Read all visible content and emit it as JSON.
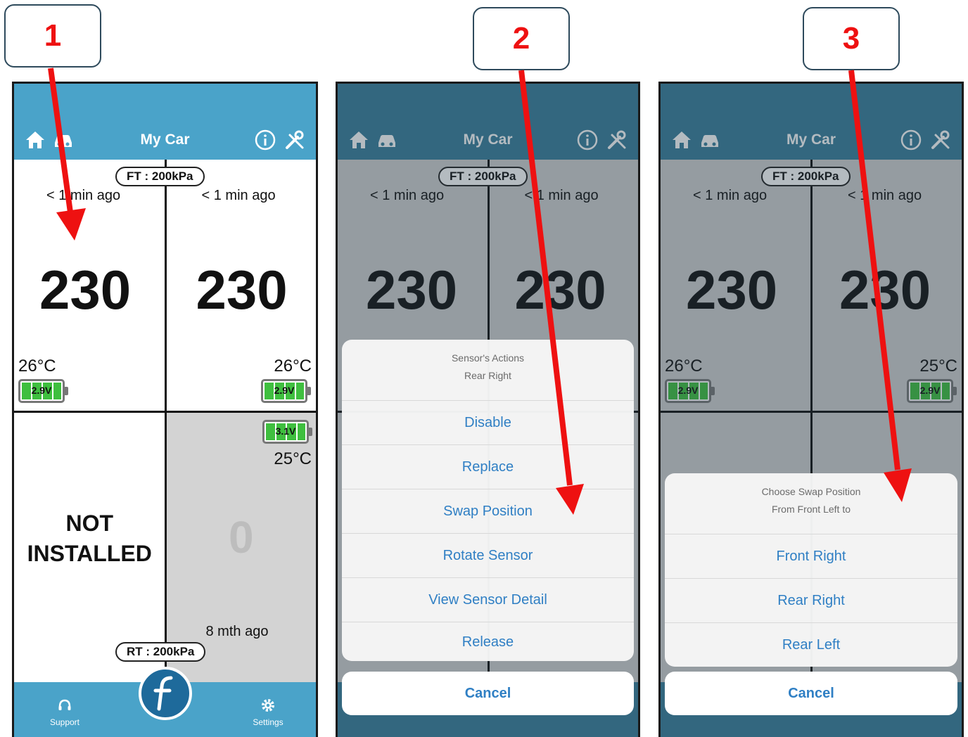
{
  "steps": [
    "1",
    "2",
    "3"
  ],
  "header": {
    "title": "My Car"
  },
  "pressure": {
    "front_label": "FT : 200kPa",
    "rear_label": "RT : 200kPa"
  },
  "tires": {
    "front_left": {
      "ago": "< 1 min ago",
      "value": "230",
      "temp": "26°C",
      "battery": "2.9V"
    },
    "front_right": {
      "ago": "< 1 min ago",
      "value": "230",
      "temp": "26°C",
      "battery": "2.9V"
    },
    "rear_left": {
      "status_line1": "NOT",
      "status_line2": "INSTALLED"
    },
    "rear_right": {
      "ago": "8 mth ago",
      "value": "0",
      "temp": "25°C",
      "battery": "3.1V"
    }
  },
  "screen3_front_right_temp": "25°C",
  "footer": {
    "support_label": "Support",
    "settings_label": "Settings"
  },
  "sensor_actions": {
    "title": "Sensor's Actions",
    "subtitle": "Rear Right",
    "items": [
      "Disable",
      "Replace",
      "Swap Position",
      "Rotate Sensor",
      "View Sensor Detail",
      "Release"
    ],
    "cancel": "Cancel"
  },
  "swap_position": {
    "title": "Choose Swap Position",
    "subtitle": "From Front Left to",
    "items": [
      "Front Right",
      "Rear Right",
      "Rear Left"
    ],
    "cancel": "Cancel"
  },
  "colors": {
    "header": "#4aa3c9",
    "link": "#2f7fc4",
    "arrow": "#ee1111",
    "battery": "#3fbf3f"
  },
  "icons": [
    "home-icon",
    "car-icon",
    "info-icon",
    "tools-icon",
    "headset-icon",
    "gear-icon"
  ]
}
